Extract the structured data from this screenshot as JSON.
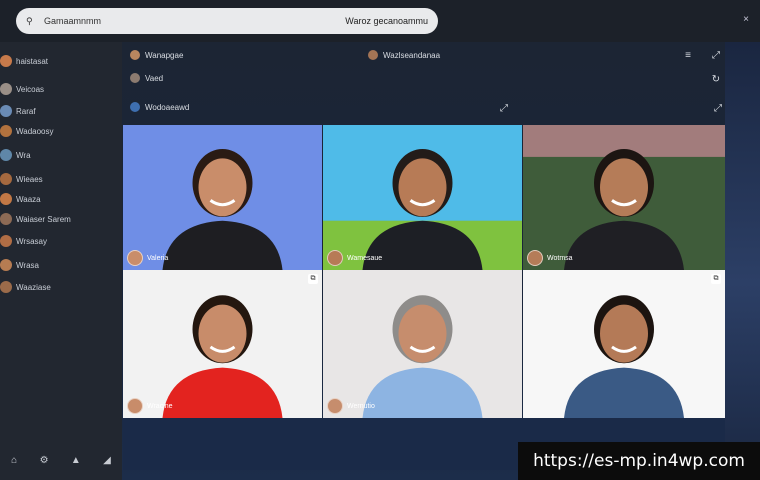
{
  "topbar": {
    "search_left_text": "Gamaamnmm",
    "search_right_text": "Waroz gecanoammu",
    "close_icon": "×"
  },
  "sidebar": {
    "items": [
      {
        "label": "haistasat",
        "avatar_color": "#c77a4b"
      },
      {
        "label": "Veicoas",
        "avatar_color": "#9a8f87"
      },
      {
        "label": "Raraf",
        "avatar_color": "#6a8bb5"
      },
      {
        "label": "Wadaoosy",
        "avatar_color": "#b2723e"
      },
      {
        "label": "Wra",
        "avatar_color": "#5f87a8"
      },
      {
        "label": "Wieaes",
        "avatar_color": "#a5693f"
      },
      {
        "label": "Waaza",
        "avatar_color": "#c27845"
      },
      {
        "label": "Waiaser Sarem",
        "avatar_color": "#8c6a55"
      },
      {
        "label": "Wrsasay",
        "avatar_color": "#b06d45"
      },
      {
        "label": "Wrasa",
        "avatar_color": "#b67c52"
      },
      {
        "label": "Waaziase",
        "avatar_color": "#9b6b4a"
      }
    ],
    "bottom_icons": [
      "⌂",
      "⚙",
      "▲",
      "◢"
    ]
  },
  "header": {
    "row1_title": "Wanapgae",
    "row1_center": "Wazlseandanaa",
    "row2_title": "Vaed",
    "row3_title": "Wodoaeawd"
  },
  "tiles": [
    {
      "name": "Valeria",
      "bg": "#6f8ee6",
      "shirt": "#1e1e22",
      "skin": "#c98d6a",
      "hair": "#2a1b14"
    },
    {
      "name": "Wamesaue",
      "bg": "#4fbbe8",
      "shirt": "#1d1f25",
      "skin": "#b77b56",
      "hair": "#231c19"
    },
    {
      "name": "Wotmsa",
      "bg": "#3f5c3a",
      "shirt": "#1f1f24",
      "skin": "#b57c58",
      "hair": "#1c1512"
    },
    {
      "name": "Wracine",
      "bg": "#f2f2f2",
      "shirt": "#e3231f",
      "skin": "#c88c6a",
      "hair": "#24170f"
    },
    {
      "name": "Wernutio",
      "bg": "#e8e6e6",
      "shirt": "#8db4e2",
      "skin": "#c68d6d",
      "hair": "#8e8c8a"
    },
    {
      "name": "",
      "bg": "#f7f7f7",
      "shirt": "#3a5a85",
      "skin": "#b47a57",
      "hair": "#1c1410"
    }
  ],
  "watermark": "https://es-mp.in4wp.com"
}
